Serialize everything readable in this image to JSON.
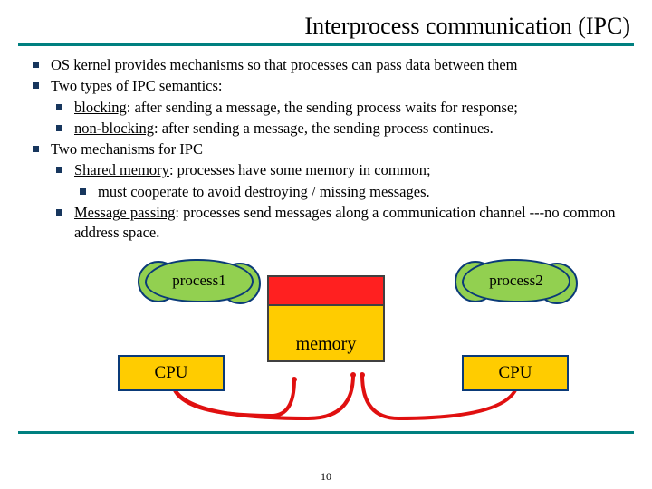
{
  "title": "Interprocess communication (IPC)",
  "bullets": {
    "b1": "OS kernel provides mechanisms so that processes can pass data between them",
    "b2": "Two types of IPC semantics:",
    "b2a_label": "blocking",
    "b2a_rest": ": after sending a message, the sending process waits for response;",
    "b2b_label": "non-blocking",
    "b2b_rest": ": after sending a message, the sending process continues.",
    "b3": "Two mechanisms for IPC",
    "b3a_label": "Shared memory",
    "b3a_rest": ": processes have some memory in common;",
    "b3a_i": "must cooperate to avoid destroying / missing messages.",
    "b3b_label": "Message passing",
    "b3b_rest": ": processes send messages along a communication channel ---no common address space."
  },
  "diagram": {
    "process1": "process1",
    "process2": "process2",
    "memory": "memory",
    "cpu": "CPU"
  },
  "page": "10"
}
